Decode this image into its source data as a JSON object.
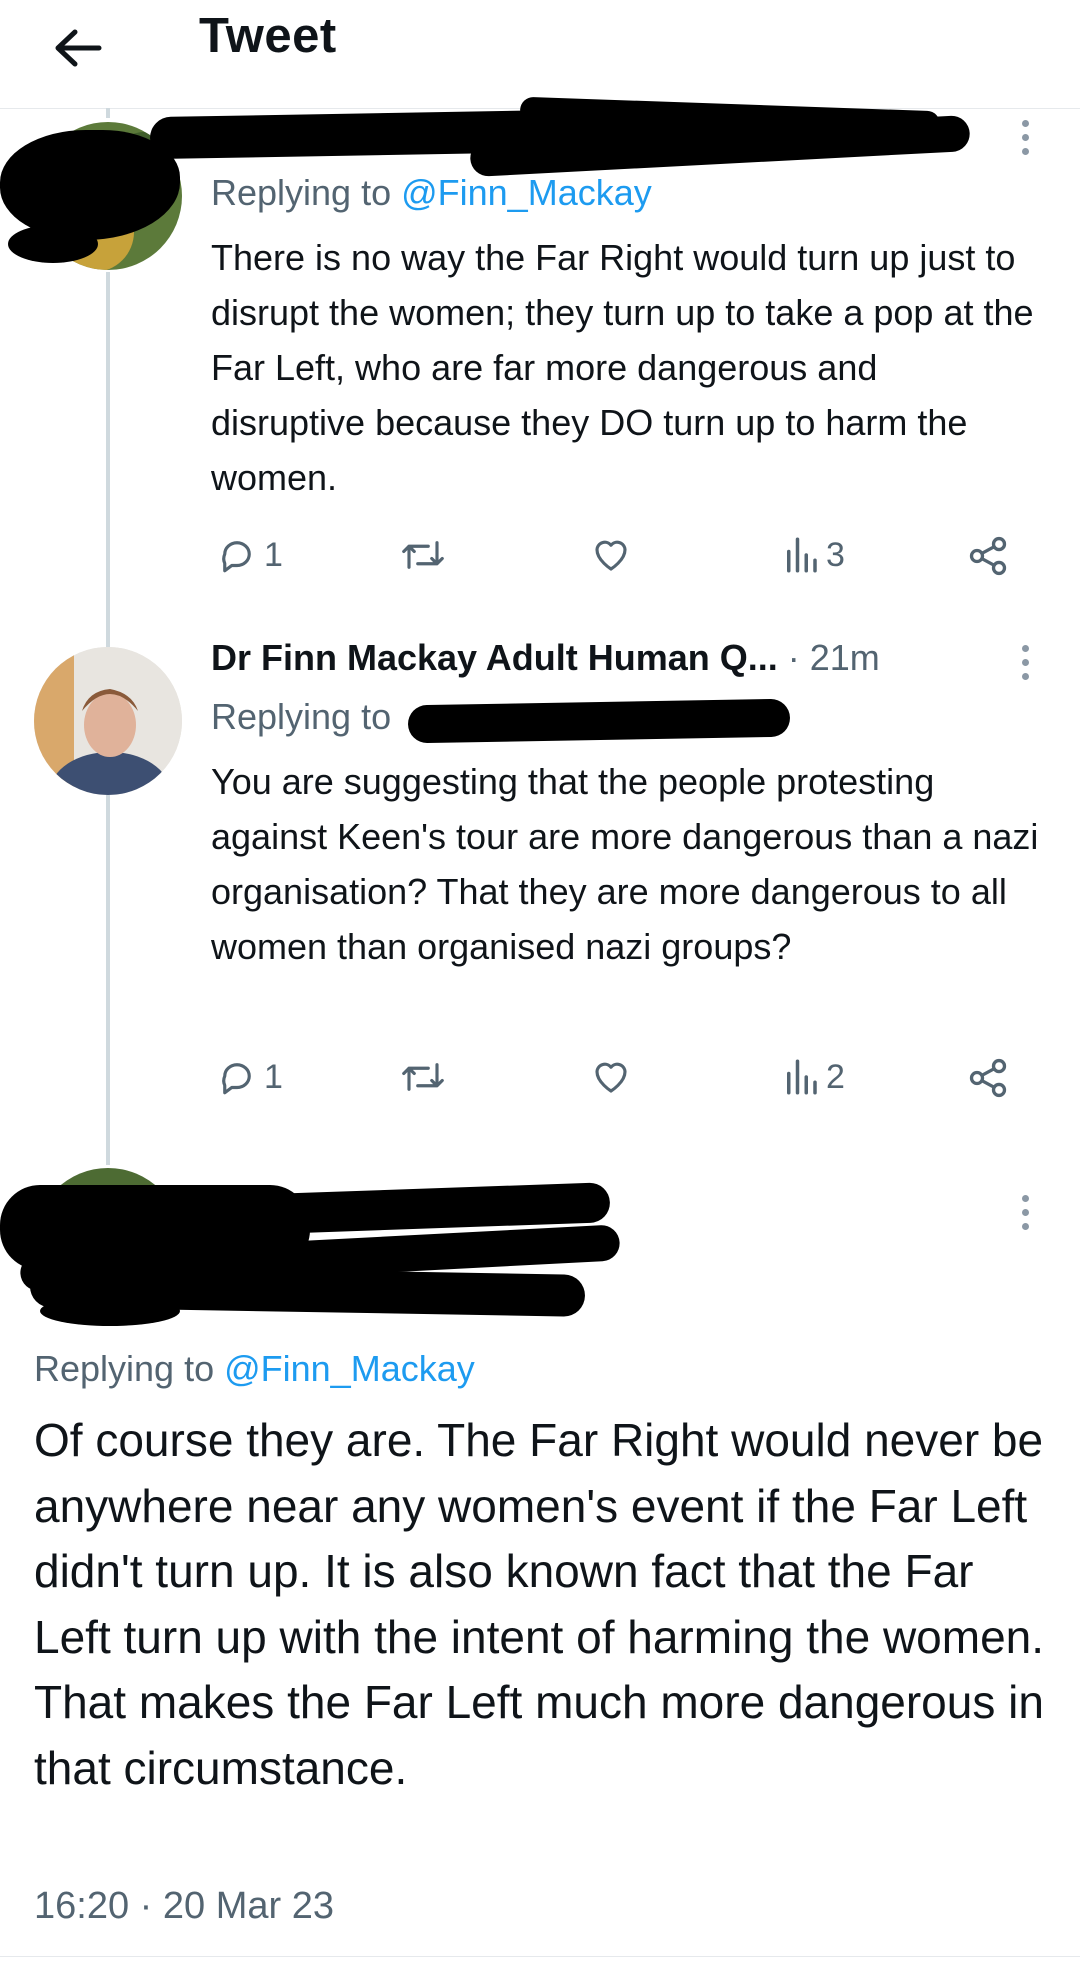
{
  "header": {
    "title": "Tweet"
  },
  "tweet1": {
    "replying_prefix": "Replying to ",
    "replying_handle": "@Finn_Mackay",
    "text": "There is no way the Far Right would turn up just to disrupt the women; they turn up to take a pop at the Far Left, who are far more dangerous and disruptive because they DO turn up to harm the women.",
    "replies": "1",
    "views": "3"
  },
  "tweet2": {
    "name": "Dr Finn Mackay Adult Human Q...",
    "time": " · 21m",
    "replying_prefix": "Replying to",
    "text": "You are suggesting that the people protesting against Keen's tour are more dangerous than a nazi organisation? That they are more dangerous to all women than organised nazi groups?",
    "replies": "1",
    "views": "2"
  },
  "main_tweet": {
    "replying_prefix": "Replying to ",
    "replying_handle": "@Finn_Mackay",
    "text": "Of course they are.  The Far Right would never be anywhere near any women's event if the Far Left didn't turn up.  It is also known fact that the Far Left turn up with the intent of harming the women.  That makes the Far Left much more dangerous in that circumstance.",
    "timestamp": "16:20 · 20 Mar 23"
  },
  "icons": {
    "back": "back-arrow-icon",
    "reply": "reply-icon",
    "retweet": "retweet-icon",
    "like": "heart-icon",
    "views": "views-icon",
    "share": "share-icon",
    "more": "more-vertical-icon"
  },
  "colors": {
    "link": "#1d9bf0",
    "secondary": "#536471",
    "text": "#0f1419",
    "thread": "#cfd9de"
  }
}
